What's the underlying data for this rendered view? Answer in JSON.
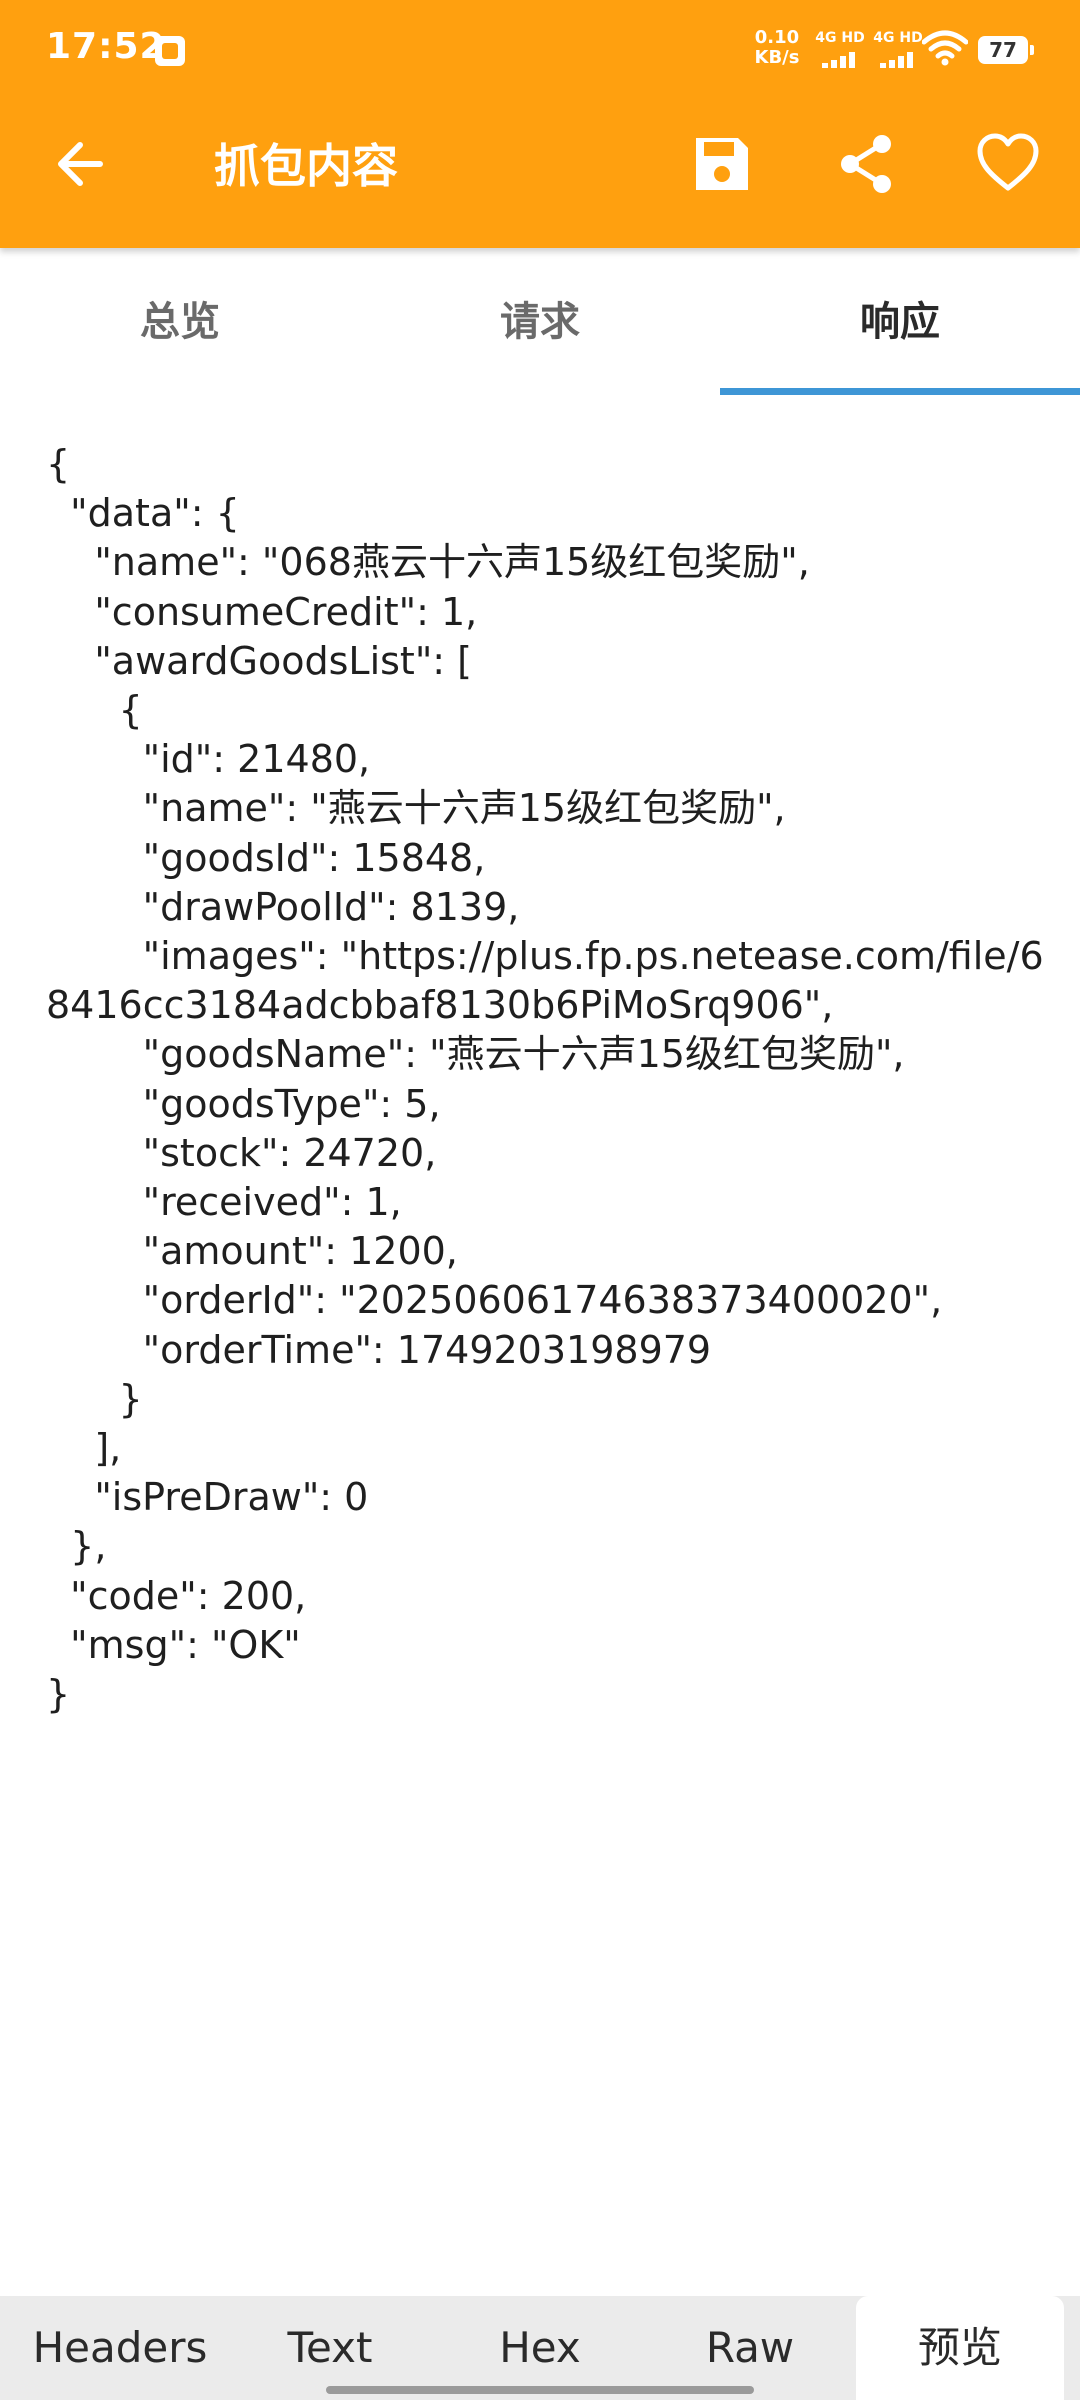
{
  "status_bar": {
    "time": "17:52",
    "net_speed_value": "0.10",
    "net_speed_unit": "KB/s",
    "sim1_label": "4G HD",
    "sim2_label": "4G HD",
    "battery": "77"
  },
  "toolbar": {
    "title": "抓包内容",
    "icons": [
      "back-arrow-icon",
      "save-icon",
      "share-icon",
      "heart-icon"
    ],
    "accent_color": "#FFA00F"
  },
  "tabs": [
    {
      "label": "总览",
      "active": false
    },
    {
      "label": "请求",
      "active": false
    },
    {
      "label": "响应",
      "active": true
    }
  ],
  "tab_indicator_color": "#3E96D6",
  "response": {
    "body": "{\n  \"data\": {\n    \"name\": \"068燕云十六声15级红包奖励\",\n    \"consumeCredit\": 1,\n    \"awardGoodsList\": [\n      {\n        \"id\": 21480,\n        \"name\": \"燕云十六声15级红包奖励\",\n        \"goodsId\": 15848,\n        \"drawPoolId\": 8139,\n        \"images\": \"https://plus.fp.ps.netease.com/file/68416cc3184adcbbaf8130b6PiMoSrq906\",\n        \"goodsName\": \"燕云十六声15级红包奖励\",\n        \"goodsType\": 5,\n        \"stock\": 24720,\n        \"received\": 1,\n        \"amount\": 1200,\n        \"orderId\": \"20250606174638373400020\",\n        \"orderTime\": 1749203198979\n      }\n    ],\n    \"isPreDraw\": 0\n  },\n  \"code\": 200,\n  \"msg\": \"OK\"\n}"
  },
  "bottom_tabs": [
    {
      "label": "Headers",
      "selected": false
    },
    {
      "label": "Text",
      "selected": false
    },
    {
      "label": "Hex",
      "selected": false
    },
    {
      "label": "Raw",
      "selected": false
    },
    {
      "label": "预览",
      "selected": true
    }
  ]
}
